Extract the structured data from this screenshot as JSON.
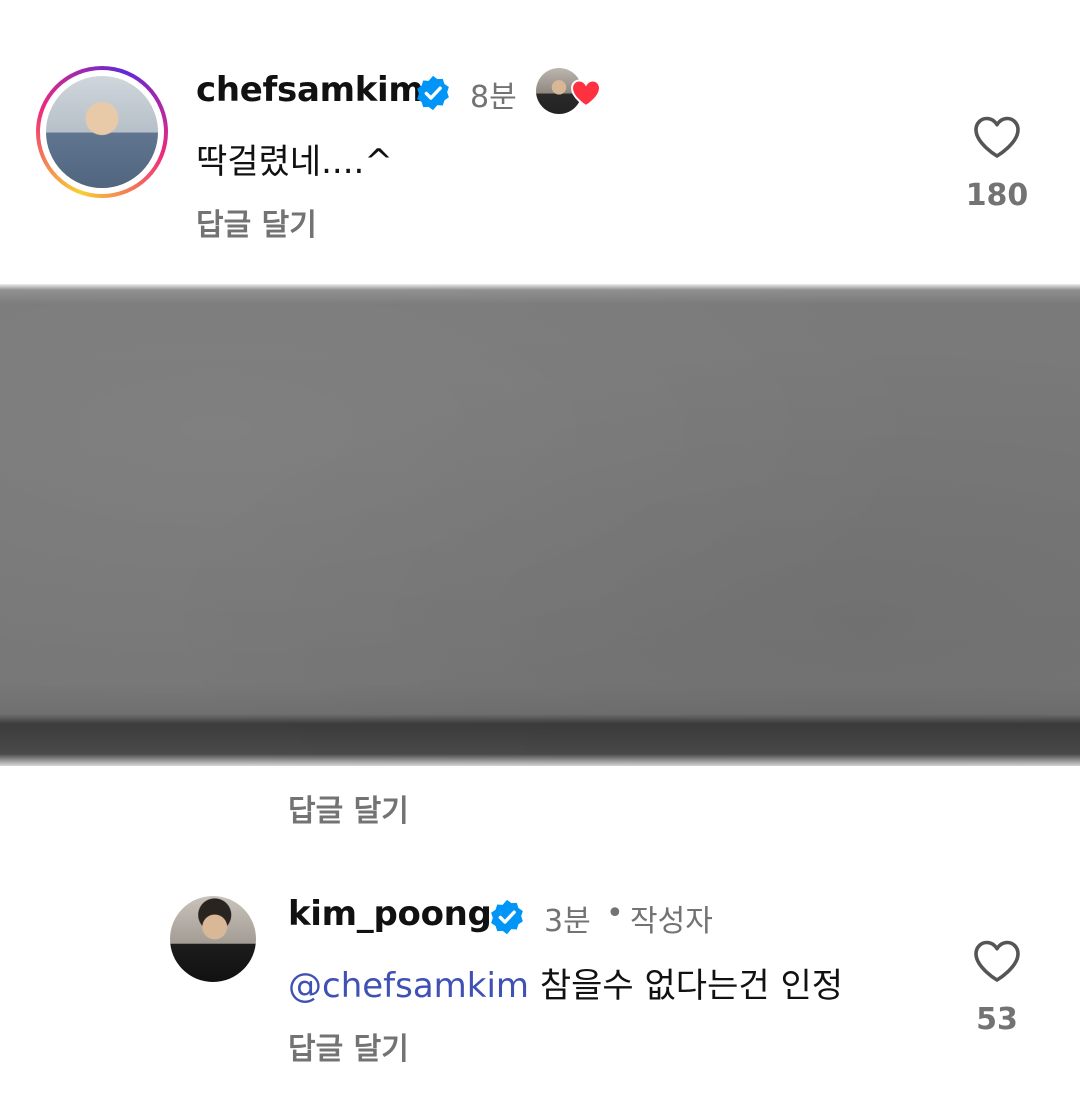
{
  "comments": [
    {
      "username": "chefsamkim",
      "time": "8분",
      "text": "딱걸렸네....^",
      "reply_label": "답글 달기",
      "likes": "180",
      "avatar_icon": "profile-photo",
      "liked_by_author": true
    },
    {
      "reply_label": "답글 달기"
    },
    {
      "username": "kim_poong",
      "time": "3분",
      "separator": "•",
      "author_badge": "작성자",
      "mention": "@chefsamkim",
      "text": "참을수 없다는건 인정",
      "reply_label": "답글 달기",
      "likes": "53",
      "avatar_icon": "profile-photo"
    }
  ],
  "colors": {
    "verified": "#0095f6",
    "like_heart": "#ff3040",
    "mention": "#3f51b5",
    "secondary_text": "#737373"
  },
  "media": {
    "type": "image"
  }
}
